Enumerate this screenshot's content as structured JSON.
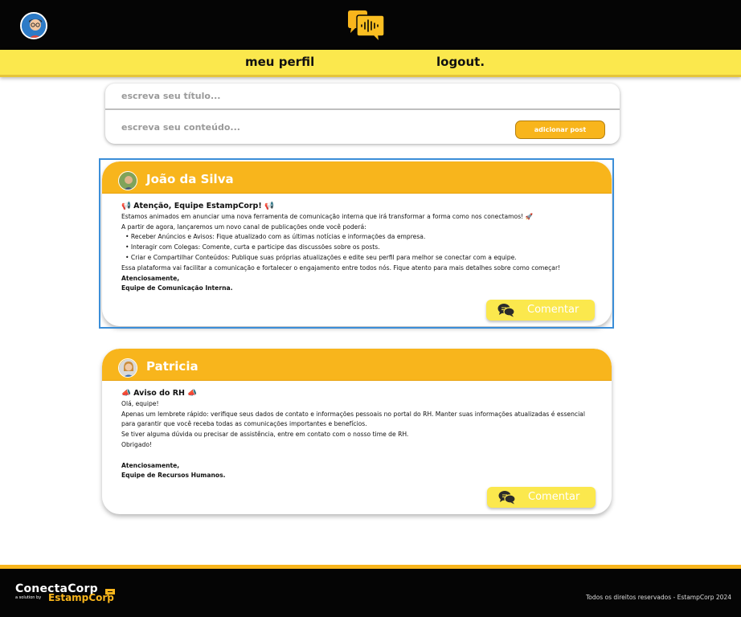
{
  "header": {
    "nav": {
      "profile_label": "meu perfil",
      "logout_label": "logout."
    },
    "logo_icon": "speech-bubble-soundwave-icon",
    "avatar_icon": "user-avatar-icon"
  },
  "composer": {
    "title_placeholder": "escreva seu título...",
    "content_placeholder": "escreva seu conteúdo...",
    "submit_label": "adicionar post"
  },
  "posts": [
    {
      "author": "João da Silva",
      "title": "📢 Atenção, Equipe EstampCorp! 📢",
      "intro": "Estamos animados em anunciar uma nova ferramenta de comunicação interna que irá transformar a forma como nos conectamos! 🚀",
      "lead": "A partir de agora, lançaremos um novo canal de publicações onde você poderá:",
      "bullets": [
        "Receber Anúncios e Avisos: Fique atualizado com as últimas notícias e informações da empresa.",
        "Interagir com Colegas: Comente, curta e participe das discussões sobre os posts.",
        "Criar e Compartilhar Conteúdos: Publique suas próprias atualizações e edite seu perfil para melhor se conectar com a equipe."
      ],
      "closing": "Essa plataforma vai facilitar a comunicação e fortalecer o engajamento entre todos nós. Fique atento para mais detalhes sobre como começar!",
      "signoff_1": "Atenciosamente,",
      "signoff_2": "Equipe de Comunicação Interna.",
      "comment_label": "Comentar"
    },
    {
      "author": "Patricia",
      "title": "📣 Aviso do RH 📣",
      "line_1": "Olá, equipe!",
      "line_2": "Apenas um lembrete rápido: verifique seus dados de contato e informações pessoais no portal do RH. Manter suas informações atualizadas é essencial para garantir que você receba todas as comunicações importantes e benefícios.",
      "line_3": "Se tiver alguma dúvida ou precisar de assistência, entre em contato com o nosso time de RH.",
      "line_4": "Obrigado!",
      "signoff_1": "Atenciosamente,",
      "signoff_2": "Equipe de Recursos Humanos.",
      "comment_label": "Comentar"
    }
  ],
  "footer": {
    "brand": "ConectaCorp",
    "brand_by": "a solution by",
    "brand_sub": "EstampCorp",
    "copyright": "Todos os direitos reservados - EstampCorp 2024"
  },
  "colors": {
    "accent_yellow": "#f8b51c",
    "nav_yellow": "#fbe84d",
    "header_black": "#050505",
    "selection_blue": "#3b8ed8"
  }
}
